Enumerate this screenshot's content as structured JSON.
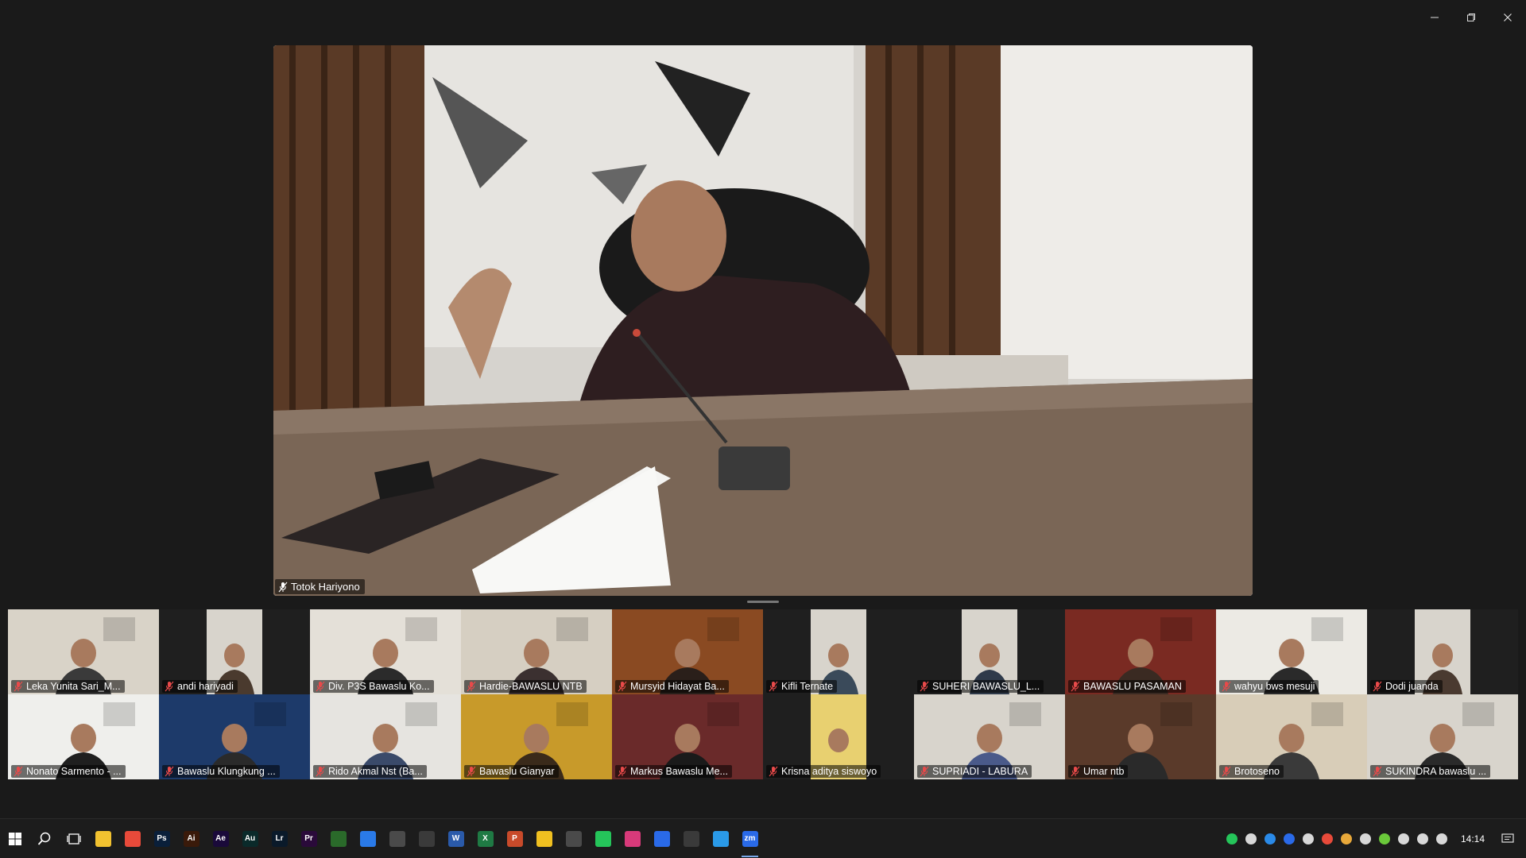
{
  "window": {
    "controls": [
      {
        "name": "minimize-button"
      },
      {
        "name": "restore-button"
      },
      {
        "name": "close-button"
      }
    ]
  },
  "main_speaker": {
    "name": "Totok Hariyono",
    "muted": true
  },
  "participants": [
    {
      "name": "Leka Yunita Sari_M...",
      "muted": true,
      "bg": "#d9d3c8",
      "person": "#3a3a3a"
    },
    {
      "name": "andi hariyadi",
      "muted": true,
      "bg": "#2a2a2a",
      "person": "#4a3a2e"
    },
    {
      "name": "Div. P3S Bawaslu Ko...",
      "muted": true,
      "bg": "#e4e0d8",
      "person": "#2b2b2b"
    },
    {
      "name": "Hardie-BAWASLU NTB",
      "muted": true,
      "bg": "#d6cfc2",
      "person": "#3b3030"
    },
    {
      "name": "Mursyid Hidayat Ba...",
      "muted": true,
      "bg": "#8a4a22",
      "person": "#2a1f1a"
    },
    {
      "name": "Kifli Ternate",
      "muted": true,
      "bg": "#262626",
      "person": "#3a4a5a"
    },
    {
      "name": "SUHERI BAWASLU_L...",
      "muted": true,
      "bg": "#262626",
      "person": "#2f3a4a"
    },
    {
      "name": "BAWASLU PASAMAN",
      "muted": true,
      "bg": "#7a2a22",
      "person": "#3a2a22"
    },
    {
      "name": "wahyu bws mesuji",
      "muted": true,
      "bg": "#eceae4",
      "person": "#2a2a2a"
    },
    {
      "name": "Dodi juanda",
      "muted": true,
      "bg": "#262626",
      "person": "#4a3a30"
    },
    {
      "name": "Nonato Sarmento - ...",
      "muted": true,
      "bg": "#efefec",
      "person": "#1f1f1f"
    },
    {
      "name": "Bawaslu Klungkung ...",
      "muted": true,
      "bg": "#1d3a6a",
      "person": "#2a2a2a"
    },
    {
      "name": "Rido Akmal Nst (Ba...",
      "muted": true,
      "bg": "#e6e4e0",
      "person": "#3a4a6a"
    },
    {
      "name": "Bawaslu Gianyar",
      "muted": true,
      "bg": "#c89a2a",
      "person": "#3a2a1a"
    },
    {
      "name": "Markus Bawaslu Me...",
      "muted": true,
      "bg": "#6a2a2a",
      "person": "#1a1a1a"
    },
    {
      "name": "Krisna aditya siswoyo",
      "muted": true,
      "bg": "#262626",
      "person": "#e8d070"
    },
    {
      "name": "SUPRIADI - LABURA",
      "muted": true,
      "bg": "#d8d4cc",
      "person": "#4a5a8a"
    },
    {
      "name": "Umar ntb",
      "muted": true,
      "bg": "#5a3a2a",
      "person": "#2a2a2a"
    },
    {
      "name": "Brotoseno",
      "muted": true,
      "bg": "#d8cdb8",
      "person": "#3a3a3a"
    },
    {
      "name": "SUKINDRA bawaslu ...",
      "muted": true,
      "bg": "#d8d4cc",
      "person": "#2a2a2a"
    }
  ],
  "taskbar": {
    "apps": [
      {
        "name": "start-icon",
        "label": "",
        "color": "#ffffff"
      },
      {
        "name": "search-icon",
        "label": "",
        "color": "#ffffff"
      },
      {
        "name": "task-view-icon",
        "label": "",
        "color": "#ffffff"
      },
      {
        "name": "file-explorer-icon",
        "label": "",
        "color": "#f2c230"
      },
      {
        "name": "chrome-icon",
        "label": "",
        "color": "#e84a3a"
      },
      {
        "name": "photoshop-icon",
        "label": "Ps",
        "color": "#0a1f3a"
      },
      {
        "name": "illustrator-icon",
        "label": "Ai",
        "color": "#3a1a0a"
      },
      {
        "name": "after-effects-icon",
        "label": "Ae",
        "color": "#1a0a3a"
      },
      {
        "name": "audition-icon",
        "label": "Au",
        "color": "#0a2a2a"
      },
      {
        "name": "lightroom-icon",
        "label": "Lr",
        "color": "#0a1a2a"
      },
      {
        "name": "premiere-icon",
        "label": "Pr",
        "color": "#2a0a3a"
      },
      {
        "name": "pen-tool-icon",
        "label": "",
        "color": "#2a6a2a"
      },
      {
        "name": "browser-icon",
        "label": "",
        "color": "#2a7ae8"
      },
      {
        "name": "app-icon",
        "label": "",
        "color": "#4a4a4a"
      },
      {
        "name": "terminal-icon",
        "label": "",
        "color": "#3a3a3a"
      },
      {
        "name": "word-icon",
        "label": "W",
        "color": "#2a5aaa"
      },
      {
        "name": "excel-icon",
        "label": "X",
        "color": "#1f7a44"
      },
      {
        "name": "powerpoint-icon",
        "label": "P",
        "color": "#c84a2a"
      },
      {
        "name": "sticky-notes-icon",
        "label": "",
        "color": "#f0c020"
      },
      {
        "name": "calculator-icon",
        "label": "",
        "color": "#4a4a4a"
      },
      {
        "name": "whatsapp-icon",
        "label": "",
        "color": "#25c55a"
      },
      {
        "name": "instagram-icon",
        "label": "",
        "color": "#d83a7a"
      },
      {
        "name": "facebook-icon",
        "label": "",
        "color": "#2a6ae8"
      },
      {
        "name": "threads-icon",
        "label": "",
        "color": "#3a3a3a"
      },
      {
        "name": "bluesky-icon",
        "label": "",
        "color": "#2a9ae8"
      },
      {
        "name": "zoom-icon",
        "label": "zm",
        "color": "#2a6ae8",
        "active": true
      }
    ],
    "tray": [
      {
        "name": "whatsapp-tray-icon",
        "color": "#25c55a"
      },
      {
        "name": "app-tray-icon",
        "color": "#d8d8d8"
      },
      {
        "name": "bluetooth-icon",
        "color": "#2a8ae8"
      },
      {
        "name": "zoom-tray-icon",
        "color": "#2a6ae8"
      },
      {
        "name": "onedrive-icon",
        "color": "#d8d8d8"
      },
      {
        "name": "antivirus-icon",
        "color": "#e84a3a"
      },
      {
        "name": "color-app-icon",
        "color": "#e8a83a"
      },
      {
        "name": "shield-icon",
        "color": "#d8d8d8"
      },
      {
        "name": "nvidia-icon",
        "color": "#6ac83a"
      },
      {
        "name": "input-icon",
        "color": "#d8d8d8"
      },
      {
        "name": "network-icon",
        "color": "#d8d8d8"
      },
      {
        "name": "volume-icon",
        "color": "#d8d8d8"
      }
    ],
    "clock": "14:14"
  }
}
